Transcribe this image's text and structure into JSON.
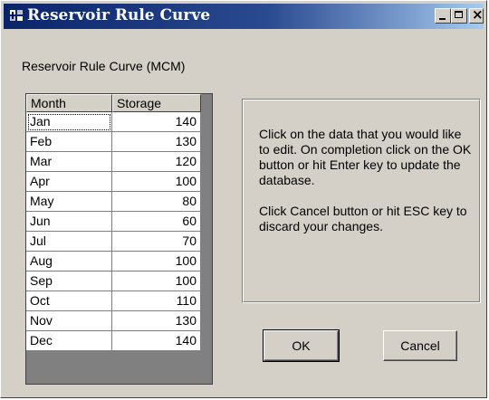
{
  "window": {
    "title": "Reservoir Rule Curve",
    "icon": "app-icon",
    "controls": [
      "minimize-icon",
      "maximize-icon",
      "close-icon"
    ]
  },
  "caption": "Reservoir Rule Curve (MCM)",
  "table": {
    "headers": [
      "Month",
      "Storage"
    ],
    "rows": [
      {
        "month": "Jan",
        "storage": "140"
      },
      {
        "month": "Feb",
        "storage": "130"
      },
      {
        "month": "Mar",
        "storage": "120"
      },
      {
        "month": "Apr",
        "storage": "100"
      },
      {
        "month": "May",
        "storage": "80"
      },
      {
        "month": "Jun",
        "storage": "60"
      },
      {
        "month": "Jul",
        "storage": "70"
      },
      {
        "month": "Aug",
        "storage": "100"
      },
      {
        "month": "Sep",
        "storage": "100"
      },
      {
        "month": "Oct",
        "storage": "110"
      },
      {
        "month": "Nov",
        "storage": "130"
      },
      {
        "month": "Dec",
        "storage": "140"
      }
    ]
  },
  "info": {
    "paragraph1": "Click on the data that you would like to edit. On completion click on the OK button or hit Enter key to update the database.",
    "paragraph2": "Click Cancel button or hit ESC key to discard your changes."
  },
  "buttons": {
    "ok": "OK",
    "cancel": "Cancel"
  }
}
